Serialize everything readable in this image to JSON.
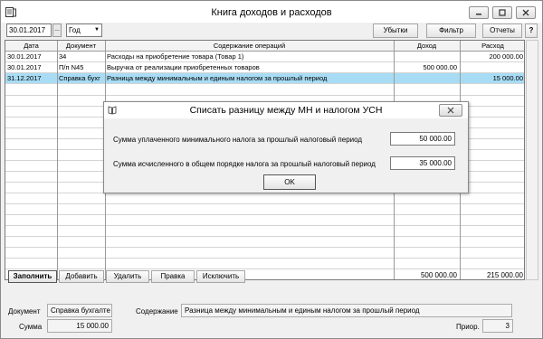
{
  "window": {
    "title": "Книга доходов и расходов"
  },
  "toolbar": {
    "date": "30.01.2017",
    "date_button": "...",
    "period": "Год",
    "buttons": {
      "bills": "Убытки",
      "filter": "Фильтр",
      "reports": "Отчеты",
      "help": "?"
    }
  },
  "table": {
    "headers": {
      "date": "Дата",
      "doc": "Документ",
      "content": "Содержание операций",
      "income": "Доход",
      "expense": "Расход"
    },
    "rows": [
      {
        "date": "30.01.2017",
        "doc": "34",
        "content": "Расходы на приобретение товара (Товар 1)",
        "income": "",
        "expense": "200 000.00"
      },
      {
        "date": "30.01.2017",
        "doc": "П/п N45",
        "content": "Выручка от реализации приобретенных товаров",
        "income": "500 000.00",
        "expense": ""
      },
      {
        "date": "31.12.2017",
        "doc": "Справка бухг",
        "content": "Разница между минимальным и единым налогом за прошлый период",
        "income": "",
        "expense": "15 000.00"
      }
    ],
    "totals": {
      "income": "500 000.00",
      "expense": "215 000.00"
    }
  },
  "actions": {
    "fill": "Заполнить",
    "add": "Добавить",
    "delete": "Удалить",
    "edit": "Правка",
    "exclude": "Исключить"
  },
  "details": {
    "doc_label": "Документ",
    "doc_value": "Справка бухгалте",
    "content_label": "Содержание",
    "content_value": "Разница между минимальным и единым налогом за прошлый период",
    "sum_label": "Сумма",
    "sum_value": "15 000.00",
    "prior_label": "Приор.",
    "prior_value": "3"
  },
  "dialog": {
    "title": "Списать разницу между МН и налогом УСН",
    "field1_label": "Сумма уплаченного минимального налога за прошлый налоговый период",
    "field1_value": "50 000.00",
    "field2_label": "Сумма исчисленного в общем порядке налога за прошлый налоговый период",
    "field2_value": "35 000.00",
    "ok": "OK"
  },
  "colors": {
    "selection": "#a8dcf4"
  }
}
